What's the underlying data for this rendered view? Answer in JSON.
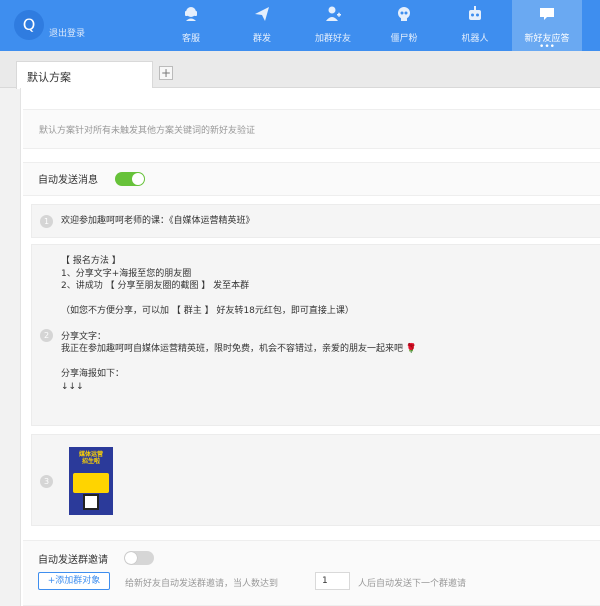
{
  "header": {
    "logo_letter": "Q",
    "logout_label": "退出登录",
    "nav": [
      {
        "label": "客服",
        "icon": "customer-service-icon"
      },
      {
        "label": "群发",
        "icon": "paper-plane-icon"
      },
      {
        "label": "加群好友",
        "icon": "add-user-icon"
      },
      {
        "label": "僵尸粉",
        "icon": "skull-icon"
      },
      {
        "label": "机器人",
        "icon": "robot-icon"
      },
      {
        "label": "新好友应答",
        "icon": "chat-bubble-icon",
        "more": "•••"
      }
    ],
    "active_index": 5,
    "colors": {
      "bar": "#3e8eef",
      "active": "#6aa9f2"
    }
  },
  "tabs": {
    "items": [
      {
        "label": "默认方案"
      }
    ],
    "add_label": "+"
  },
  "description": "默认方案针对所有未触发其他方案关键词的新好友验证",
  "auto_send": {
    "label": "自动发送消息",
    "enabled": true
  },
  "messages": [
    {
      "index": "1",
      "text": "欢迎参加趣呵呵老师的课：《自媒体运营精英班》"
    },
    {
      "index": "2",
      "text": "【 报名方法 】\n1、分享文字+海报至您的朋友圈\n2、讲成功 【 分享至朋友圈的截图 】 发至本群\n\n（如您不方便分享，可以加 【 群主 】 好友转18元红包，即可直接上课）\n\n分享文字：\n我正在参加趣呵呵自媒体运营精英班，限时免费，机会不容错过，亲爱的朋友一起来吧 🌹\n\n分享海报如下：\n↓↓↓"
    },
    {
      "index": "3",
      "image": "poster-image",
      "poster_text": "媒体运营\n招生啦"
    }
  ],
  "group_invite": {
    "label": "自动发送群邀请",
    "enabled": false,
    "add_button": "+添加群对象",
    "text_before": "给新好友自动发送群邀请，当人数达到",
    "count_value": "1",
    "text_after": "人后自动发送下一个群邀请"
  }
}
